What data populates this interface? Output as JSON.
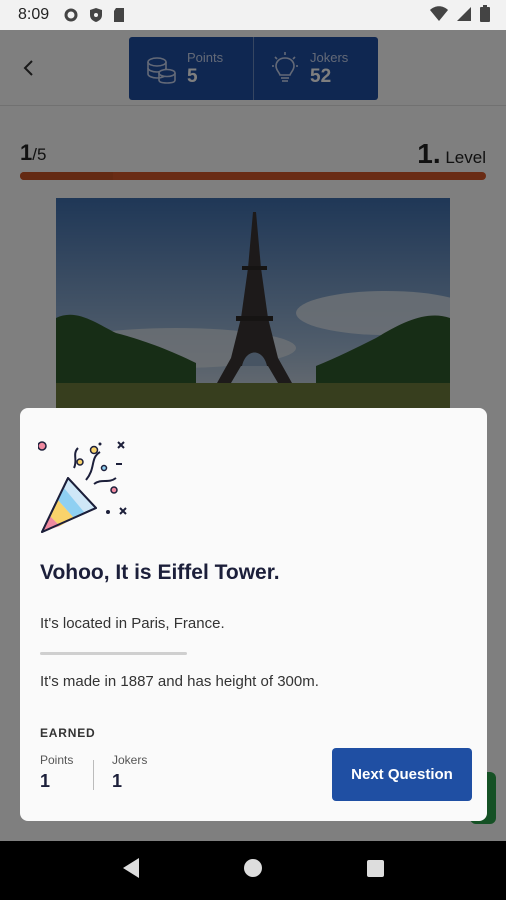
{
  "status_bar": {
    "time": "8:09"
  },
  "header": {
    "points": {
      "label": "Points",
      "value": "5"
    },
    "jokers": {
      "label": "Jokers",
      "value": "52"
    }
  },
  "progress": {
    "current": "1",
    "total": "/5",
    "level_num": "1.",
    "level_text": " Level",
    "fraction": 0.2
  },
  "modal": {
    "title": "Vohoo, It is Eiffel Tower.",
    "fact_1": "It's located in Paris, France.",
    "fact_2": "It's made in 1887 and has height of 300m.",
    "earned_label": "EARNED",
    "earned_points": {
      "label": "Points",
      "value": "1"
    },
    "earned_jokers": {
      "label": "Jokers",
      "value": "1"
    },
    "next_button": "Next Question"
  },
  "colors": {
    "primary": "#1f4fa3",
    "progress": "#d4582a",
    "green": "#2ba34a"
  }
}
